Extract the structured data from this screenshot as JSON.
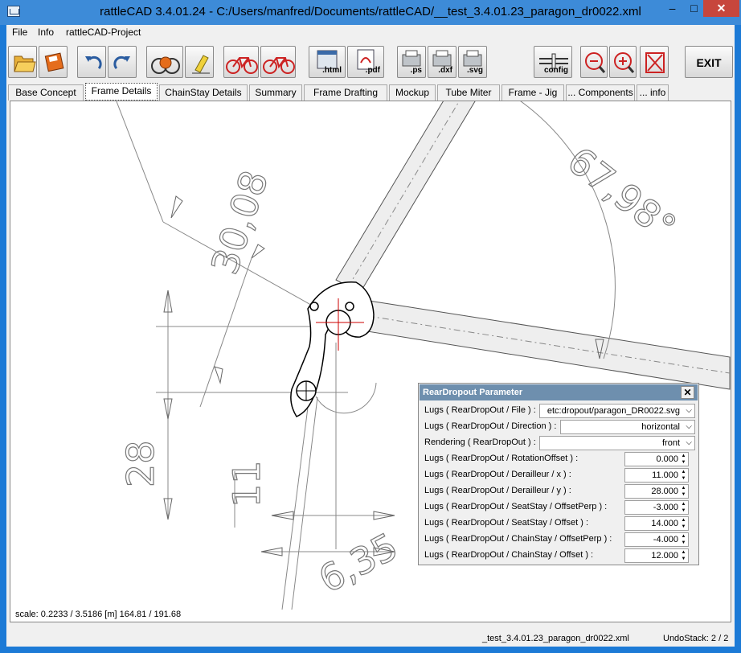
{
  "window": {
    "title": "rattleCAD  3.4.01.24 - C:/Users/manfred/Documents/rattleCAD/__test_3.4.01.23_paragon_dr0022.xml",
    "minimize": "–",
    "maximize": "□",
    "close": "✕"
  },
  "menu": [
    "File",
    "Info",
    "rattleCAD-Project"
  ],
  "toolbar": {
    "html_label": ".html",
    "pdf_label": ".pdf",
    "ps_label": ".ps",
    "dxf_label": ".dxf",
    "svg_label": ".svg",
    "config_label": "config",
    "exit_label": "EXIT",
    "icons": [
      "open-folder-icon",
      "save-icon",
      "undo-icon",
      "redo-icon",
      "render-icon",
      "eraser-icon",
      "bike-red-icon",
      "bike-red-2-icon",
      "export-html-icon",
      "export-pdf-icon",
      "export-ps-icon",
      "export-dxf-icon",
      "export-svg-icon",
      "config-icon",
      "zoom-out-icon",
      "zoom-in-icon",
      "fit-view-icon",
      "exit-icon"
    ]
  },
  "tabs": [
    {
      "label": "Base Concept",
      "active": false
    },
    {
      "label": "Frame Details",
      "active": true
    },
    {
      "label": "ChainStay Details",
      "active": false
    },
    {
      "label": "Summary",
      "active": false
    },
    {
      "label": "Frame Drafting",
      "active": false
    },
    {
      "label": "Mockup",
      "active": false
    },
    {
      "label": "Tube Miter",
      "active": false
    },
    {
      "label": "Frame - Jig",
      "active": false
    },
    {
      "label": "... Components",
      "active": false
    },
    {
      "label": "... info",
      "active": false
    }
  ],
  "drawing": {
    "dimensions": [
      "30,08",
      "67,98°",
      "28",
      "11",
      "6,35"
    ]
  },
  "scale_text": "scale: 0.2233 / 3.5186  [m]  164.81 / 191.68",
  "status": {
    "file": "_test_3.4.01.23_paragon_dr0022.xml",
    "undo": "UndoStack:  2 / 2"
  },
  "panel": {
    "title": "RearDropout Parameter",
    "close": "✕",
    "rows": [
      {
        "label": "Lugs ( RearDropOut / File ) :",
        "value": "etc:dropout/paragon_DR0022.svg",
        "kind": "select"
      },
      {
        "label": "Lugs ( RearDropOut / Direction ) :",
        "value": "horizontal",
        "kind": "select"
      },
      {
        "label": "Rendering ( RearDropOut ) :",
        "value": "front",
        "kind": "select"
      },
      {
        "label": "Lugs ( RearDropOut / RotationOffset ) :",
        "value": "0.000",
        "kind": "spin"
      },
      {
        "label": "Lugs ( RearDropOut / Derailleur / x ) :",
        "value": "11.000",
        "kind": "spin"
      },
      {
        "label": "Lugs ( RearDropOut / Derailleur / y ) :",
        "value": "28.000",
        "kind": "spin"
      },
      {
        "label": "Lugs ( RearDropOut / SeatStay / OffsetPerp ) :",
        "value": "-3.000",
        "kind": "spin"
      },
      {
        "label": "Lugs ( RearDropOut / SeatStay / Offset ) :",
        "value": "14.000",
        "kind": "spin"
      },
      {
        "label": "Lugs ( RearDropOut / ChainStay / OffsetPerp ) :",
        "value": "-4.000",
        "kind": "spin"
      },
      {
        "label": "Lugs ( RearDropOut / ChainStay / Offset ) :",
        "value": "12.000",
        "kind": "spin"
      }
    ]
  }
}
